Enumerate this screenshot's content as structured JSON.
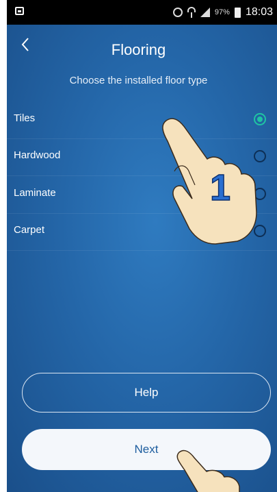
{
  "status_bar": {
    "battery_percent": "97%",
    "time": "18:03"
  },
  "header": {
    "title": "Flooring",
    "subtitle": "Choose the installed floor type"
  },
  "options": [
    {
      "label": "Tiles",
      "selected": true
    },
    {
      "label": "Hardwood",
      "selected": false
    },
    {
      "label": "Laminate",
      "selected": false
    },
    {
      "label": "Carpet",
      "selected": false
    }
  ],
  "buttons": {
    "help": "Help",
    "next": "Next"
  },
  "overlay": {
    "step_number": "1"
  },
  "colors": {
    "background": "#2466a8",
    "accent_selected": "#1fc4a3",
    "next_text": "#1d5d9e"
  }
}
